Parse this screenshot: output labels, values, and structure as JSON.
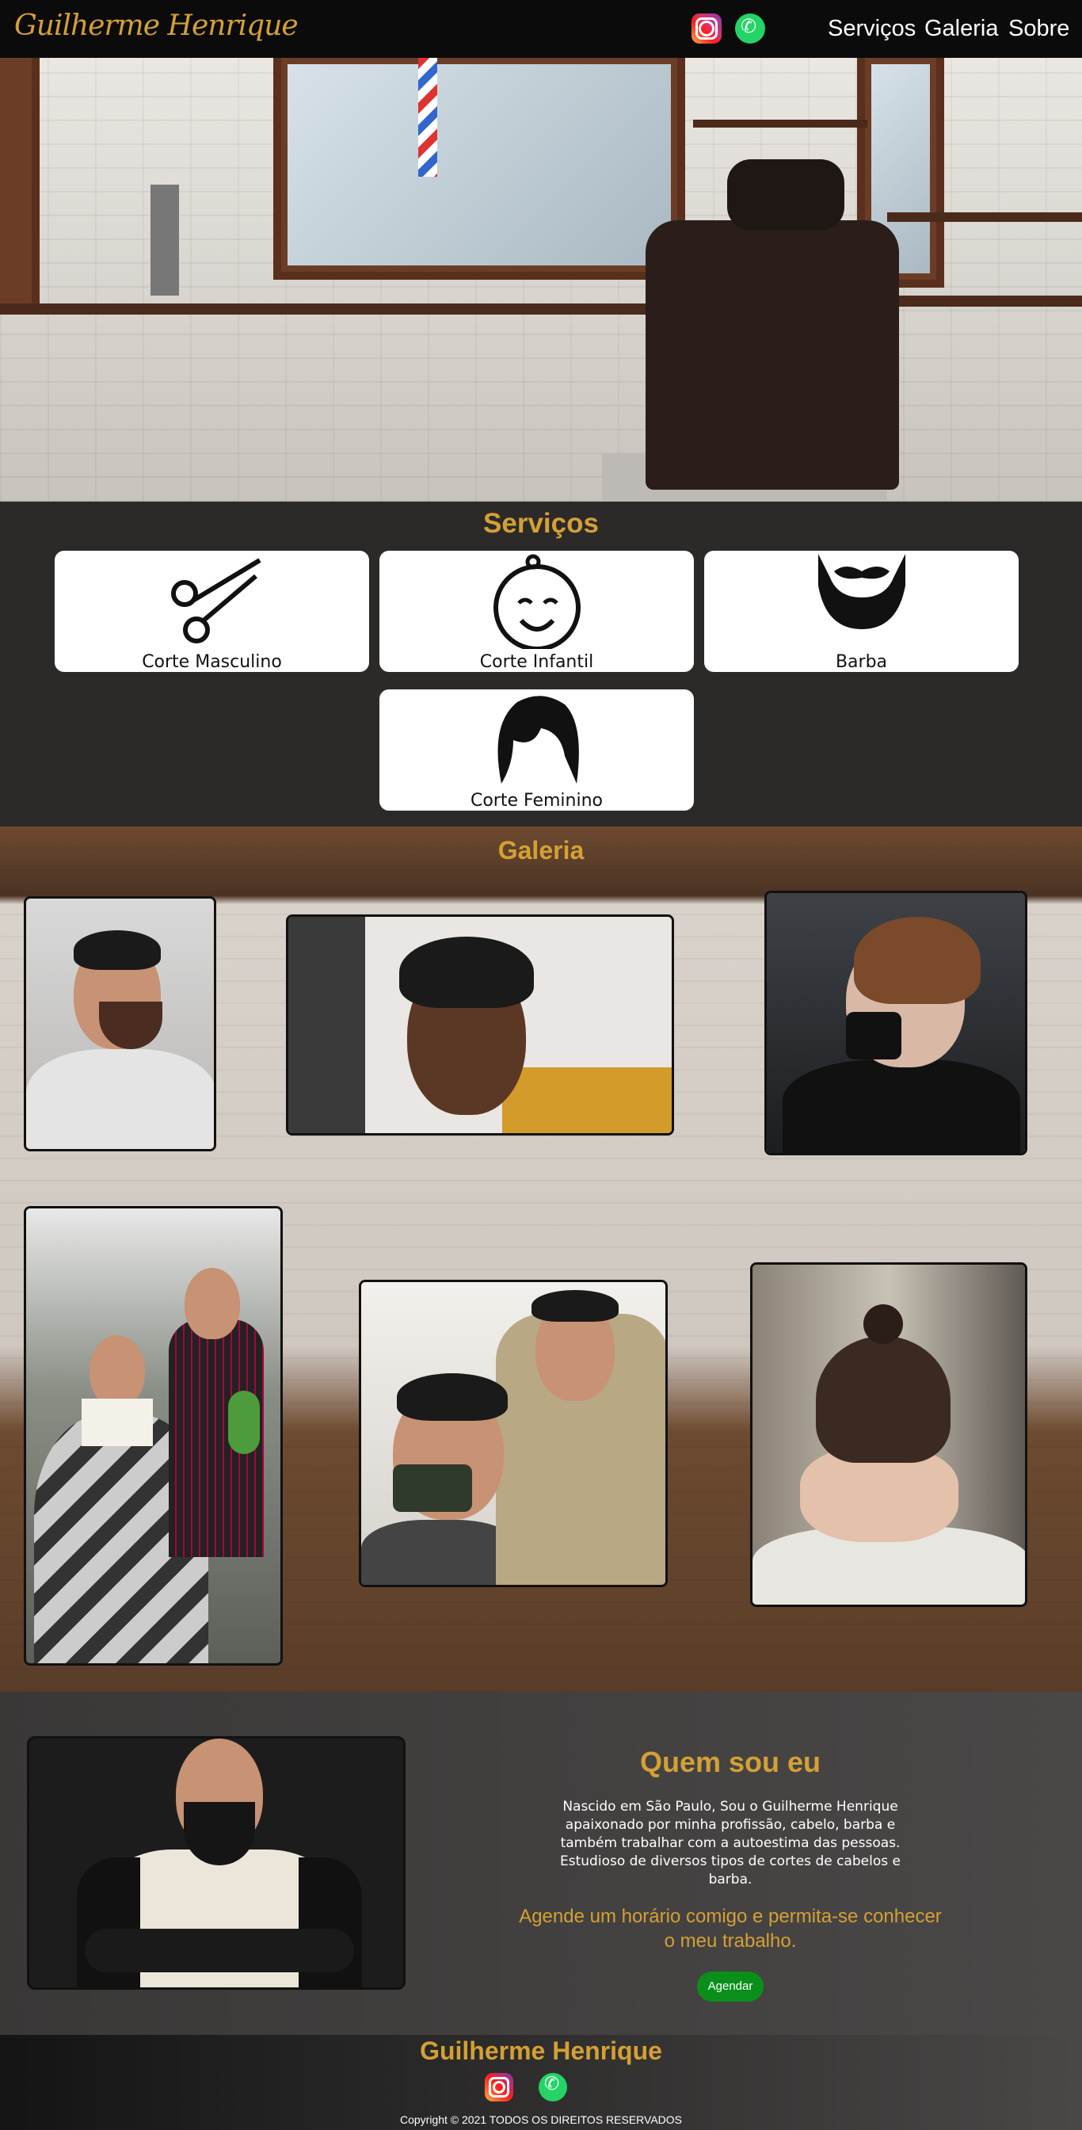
{
  "header": {
    "logo": "Guilherme Henrique",
    "icons": [
      "instagram-icon",
      "whatsapp-icon"
    ],
    "nav": [
      "Serviços",
      "Galeria",
      "Sobre"
    ]
  },
  "services": {
    "title": "Serviços",
    "cards": [
      {
        "label": "Corte Masculino",
        "icon": "scissors-icon"
      },
      {
        "label": "Corte Infantil",
        "icon": "baby-face-icon"
      },
      {
        "label": "Barba",
        "icon": "beard-icon"
      },
      {
        "label": "Corte Feminino",
        "icon": "female-hair-icon"
      }
    ]
  },
  "gallery": {
    "title": "Galeria"
  },
  "about": {
    "title": "Quem sou eu",
    "text": "Nascido em São Paulo, Sou o Guilherme Henrique apaixonado por minha profissão, cabelo, barba e também trabalhar com a autoestima das pessoas. Estudioso de diversos tipos de cortes de cabelos e barba.",
    "cta": "Agende um horário comigo e permita-se conhecer o meu trabalho.",
    "button": "Agendar"
  },
  "footer": {
    "name": "Guilherme Henrique",
    "copyright": "Copyright © 2021 TODOS OS DIREITOS RESERVADOS"
  },
  "colors": {
    "accent": "#d4a035",
    "header_bg": "#0b0b0b",
    "section_bg": "#2c2a28",
    "button": "#0a8f1a"
  }
}
